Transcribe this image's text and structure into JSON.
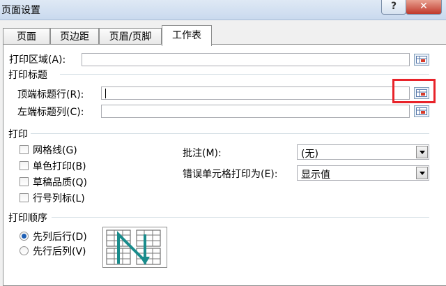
{
  "window": {
    "title": "页面设置",
    "help_label": "?",
    "close_label": "✕"
  },
  "tabs": [
    {
      "label": "页面"
    },
    {
      "label": "页边距"
    },
    {
      "label": "页眉/页脚"
    },
    {
      "label": "工作表",
      "active": true
    }
  ],
  "print_area": {
    "label": "打印区域(A):",
    "value": ""
  },
  "print_titles": {
    "heading": "打印标题",
    "rows_label": "顶端标题行(R):",
    "rows_value": "",
    "cols_label": "左端标题列(C):",
    "cols_value": ""
  },
  "print": {
    "heading": "打印",
    "checkboxes": [
      {
        "label": "网格线(G)",
        "checked": false
      },
      {
        "label": "单色打印(B)",
        "checked": false
      },
      {
        "label": "草稿品质(Q)",
        "checked": false
      },
      {
        "label": "行号列标(L)",
        "checked": false
      }
    ],
    "comments_label": "批注(M):",
    "comments_value": "(无)",
    "errors_label": "错误单元格打印为(E):",
    "errors_value": "显示值"
  },
  "order": {
    "heading": "打印顺序",
    "options": [
      {
        "label": "先列后行(D)",
        "selected": true
      },
      {
        "label": "先行后列(V)",
        "selected": false
      }
    ]
  },
  "colors": {
    "highlight": "#e8232a",
    "arrow": "#1a8c8c",
    "radio_dot": "#1e5fb4"
  },
  "icons": {
    "range_picker": "range-selector-icon",
    "order_preview": "page-order-preview-icon"
  }
}
